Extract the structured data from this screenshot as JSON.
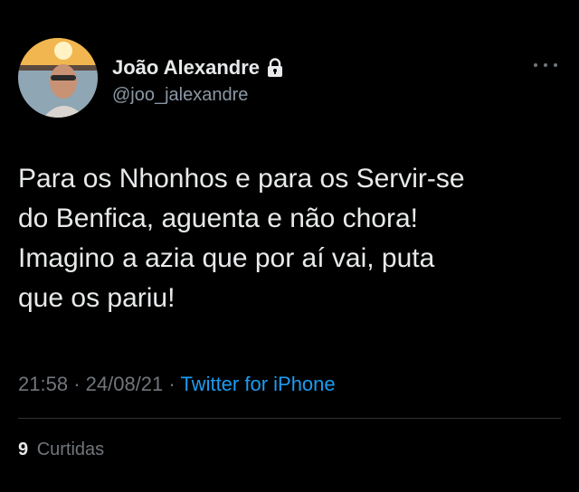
{
  "tweet": {
    "author": {
      "name": "João Alexandre",
      "handle": "@joo_jalexandre",
      "avatar_icon": "avatar-photo",
      "protected_icon": "lock-icon"
    },
    "more_icon": "more-icon",
    "text_lines": [
      "Para os Nhonhos e para os Servir-se",
      "do Benfica, aguenta e não chora!",
      "Imagino a azia que por aí vai, puta",
      "que os pariu!"
    ],
    "time": "21:58",
    "date": "24/08/21",
    "separator": "·",
    "source": "Twitter for iPhone",
    "stats": {
      "likes_count": "9",
      "likes_label": "Curtidas"
    }
  },
  "colors": {
    "background": "#000000",
    "text": "#e7e9ea",
    "secondary_text": "#71767b",
    "link": "#1d9bf0",
    "divider": "#2f3336"
  }
}
